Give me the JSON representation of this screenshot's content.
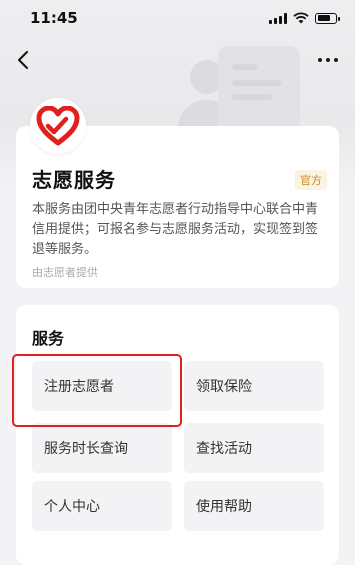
{
  "status_bar": {
    "time": "11:45"
  },
  "service": {
    "title": "志愿服务",
    "badge": "官方",
    "description": "本服务由团中央青年志愿者行动指导中心联合中青信用提供；可报名参与志愿服务活动，实现签到签退等服务。",
    "provider": "由志愿者提供"
  },
  "services_section": {
    "title": "服务",
    "items": [
      {
        "label": "注册志愿者"
      },
      {
        "label": "领取保险"
      },
      {
        "label": "服务时长查询"
      },
      {
        "label": "查找活动"
      },
      {
        "label": "个人中心"
      },
      {
        "label": "使用帮助"
      }
    ]
  },
  "colors": {
    "brand_red": "#e0201d",
    "badge_text": "#c98a2a",
    "highlight": "#e0201d"
  },
  "icons": [
    "back-arrow-icon",
    "more-dots-icon",
    "heart-hand-logo-icon",
    "wifi-icon",
    "battery-icon",
    "signal-icon"
  ],
  "battery_level": 0.75
}
